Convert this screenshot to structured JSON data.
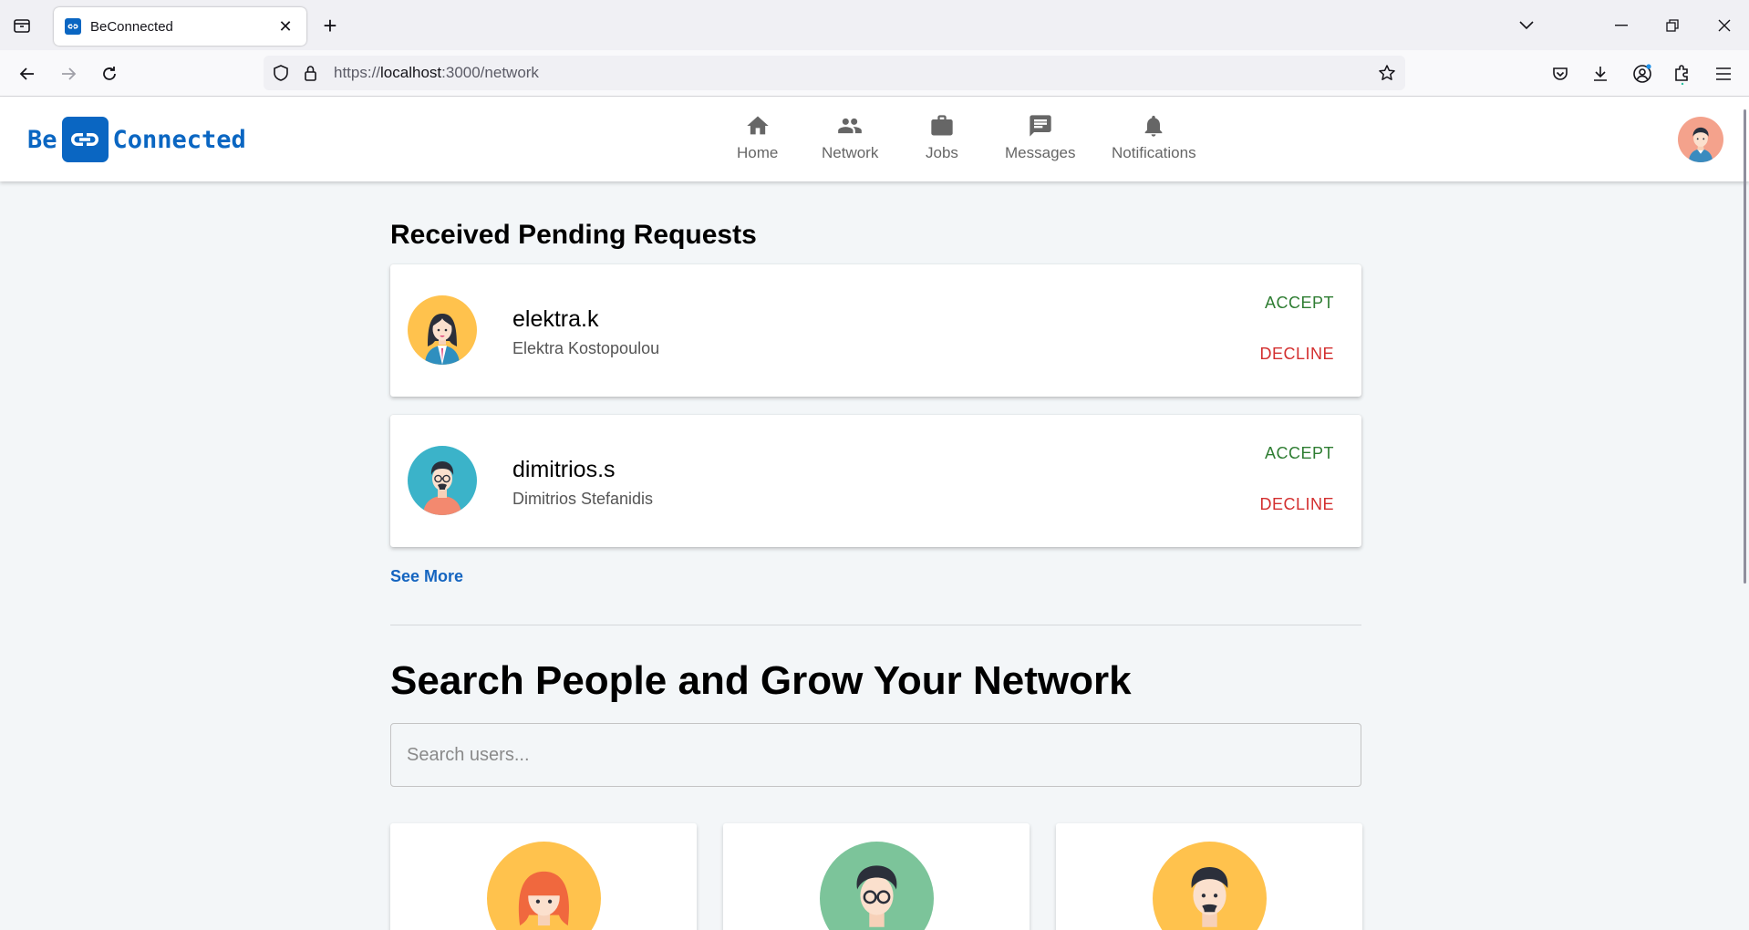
{
  "browser": {
    "tab_title": "BeConnected",
    "url_prefix": "https://",
    "url_host": "localhost",
    "url_path": ":3000/network"
  },
  "header": {
    "logo_left": "Be",
    "logo_right": "Connected",
    "nav": {
      "home": "Home",
      "network": "Network",
      "jobs": "Jobs",
      "messages": "Messages",
      "notifications": "Notifications"
    }
  },
  "pending": {
    "title": "Received Pending Requests",
    "requests": [
      {
        "username": "elektra.k",
        "full_name": "Elektra Kostopoulou",
        "accept": "ACCEPT",
        "decline": "DECLINE"
      },
      {
        "username": "dimitrios.s",
        "full_name": "Dimitrios Stefanidis",
        "accept": "ACCEPT",
        "decline": "DECLINE"
      }
    ],
    "see_more": "See More"
  },
  "search": {
    "title": "Search People and Grow Your Network",
    "placeholder": "Search users..."
  },
  "colors": {
    "brand": "#0a66c2",
    "accept": "#2e7d32",
    "decline": "#d32f2f",
    "link": "#1565c0"
  }
}
